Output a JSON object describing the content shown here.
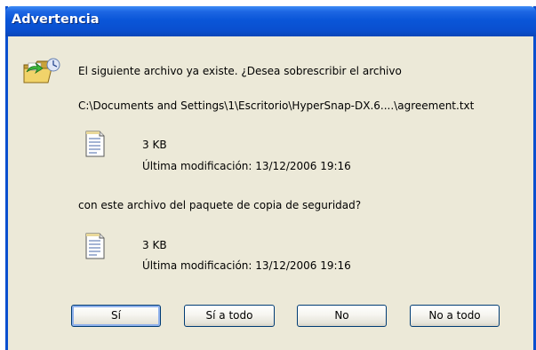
{
  "window": {
    "title": "Advertencia"
  },
  "dialog": {
    "message": "El siguiente archivo ya existe. ¿Desea sobrescribir el archivo",
    "path": "C:\\Documents and Settings\\1\\Escritorio\\HyperSnap-DX.6....\\agreement.txt",
    "existing_file": {
      "size": "3 KB",
      "modified": "Última modificación: 13/12/2006 19:16"
    },
    "question": "con este archivo del paquete de copia de seguridad?",
    "backup_file": {
      "size": "3 KB",
      "modified": "Última modificación: 13/12/2006 19:16"
    }
  },
  "buttons": {
    "yes": "Sí",
    "yes_all": "Sí a todo",
    "no": "No",
    "no_all": "No a todo"
  },
  "icons": {
    "dialog": "folder-replace-icon",
    "file": "text-file-icon"
  },
  "colors": {
    "titlebar": "#0a4fcf",
    "dialog_bg": "#ece9d8",
    "button_border": "#003c74"
  }
}
